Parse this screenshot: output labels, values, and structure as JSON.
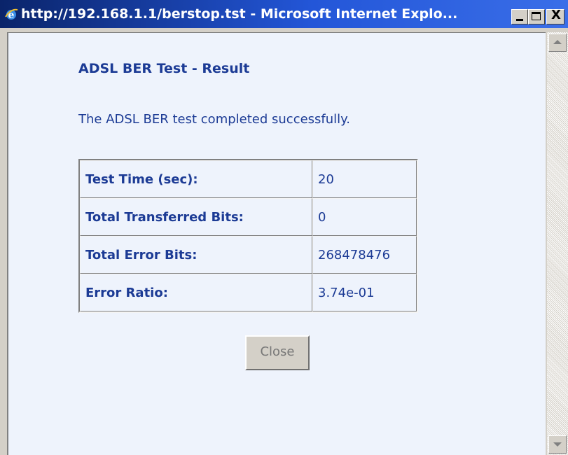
{
  "window": {
    "title": "http://192.168.1.1/berstop.tst - Microsoft Internet Explo...",
    "icon": "ie-icon",
    "buttons": [
      "minimize-icon",
      "maximize-icon",
      "close-icon"
    ],
    "close_glyph": "X"
  },
  "page": {
    "heading": "ADSL BER Test - Result",
    "message": "The ADSL BER test completed successfully.",
    "rows": [
      {
        "label": "Test Time (sec):",
        "value": "20"
      },
      {
        "label": "Total Transferred Bits:",
        "value": "0"
      },
      {
        "label": "Total Error Bits:",
        "value": "268478476"
      },
      {
        "label": "Error Ratio:",
        "value": "3.74e-01"
      }
    ],
    "close_label": "Close"
  },
  "colors": {
    "title_bar": "#0a246a",
    "text": "#1c3b95",
    "page_background": "#eef3fc"
  }
}
